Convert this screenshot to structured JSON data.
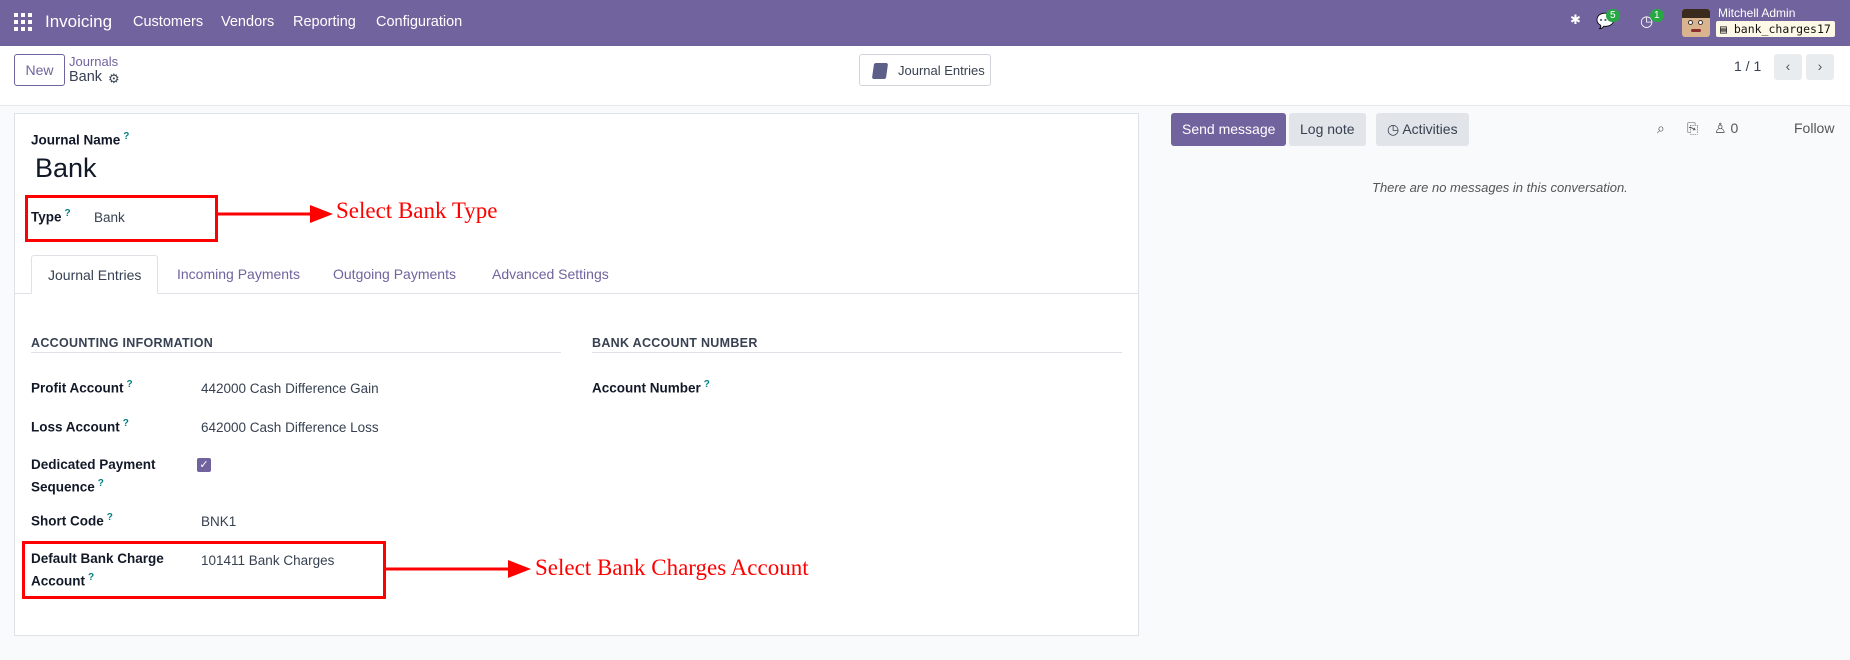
{
  "nav": {
    "app_title": "Invoicing",
    "menu": [
      "Customers",
      "Vendors",
      "Reporting",
      "Configuration"
    ],
    "messages_count": "5",
    "activities_count": "1",
    "user_name": "Mitchell Admin",
    "db_name": "bank_charges17"
  },
  "control_panel": {
    "new_label": "New",
    "breadcrumb_parent": "Journals",
    "breadcrumb_current": "Bank",
    "smart_button_label": "Journal Entries",
    "pager": "1 / 1"
  },
  "form": {
    "journal_name_label": "Journal Name",
    "journal_name": "Bank",
    "type_label": "Type",
    "type_value": "Bank",
    "tabs": [
      "Journal Entries",
      "Incoming Payments",
      "Outgoing Payments",
      "Advanced Settings"
    ],
    "accounting_section": "ACCOUNTING INFORMATION",
    "bank_section": "BANK ACCOUNT NUMBER",
    "profit_account_label": "Profit Account",
    "profit_account_value": "442000 Cash Difference Gain",
    "loss_account_label": "Loss Account",
    "loss_account_value": "642000 Cash Difference Loss",
    "dedicated_seq_label_1": "Dedicated Payment",
    "dedicated_seq_label_2": "Sequence",
    "short_code_label": "Short Code",
    "short_code_value": "BNK1",
    "bank_charge_label_1": "Default Bank Charge",
    "bank_charge_label_2": "Account",
    "bank_charge_value": "101411 Bank Charges",
    "account_number_label": "Account Number",
    "help_mark": "?"
  },
  "annotations": {
    "type_note": "Select Bank Type",
    "charges_note": "Select Bank Charges Account",
    "color": "#ff0000"
  },
  "chatter": {
    "send_message": "Send message",
    "log_note": "Log note",
    "activities": "Activities",
    "followers_count": "0",
    "follow": "Follow",
    "empty_text": "There are no messages in this conversation."
  },
  "colors": {
    "brand": "#71639e",
    "badge": "#28a745",
    "help": "#017e84"
  }
}
